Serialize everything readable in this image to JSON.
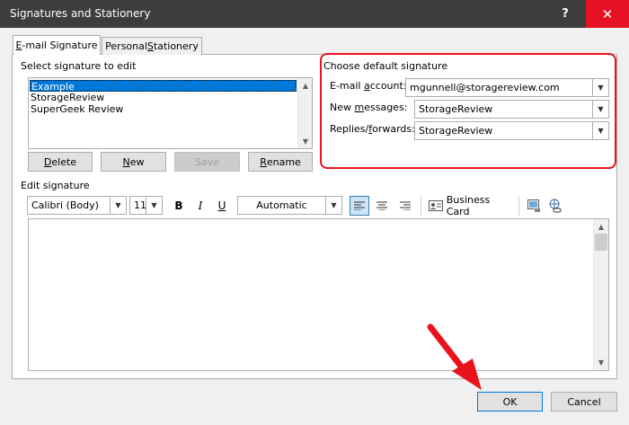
{
  "window": {
    "title": "Signatures and Stationery",
    "help_label": "?",
    "close_label": "✕"
  },
  "tabs": [
    {
      "label_accel": "E",
      "label_rest": "-mail Signature"
    },
    {
      "label_pre": "Personal ",
      "label_accel": "S",
      "label_rest": "tationery"
    }
  ],
  "select_signature": {
    "label": "Select signature to edit",
    "items": [
      "Example",
      "StorageReview",
      "SuperGeek Review"
    ],
    "selected": "Example"
  },
  "buttons": {
    "delete": {
      "accel": "D",
      "rest": "elete"
    },
    "new": {
      "accel": "N",
      "rest": "ew"
    },
    "save": "Save",
    "rename": {
      "accel": "R",
      "rest": "ename"
    },
    "ok": "OK",
    "cancel": "Cancel"
  },
  "default_signature": {
    "label": "Choose default signature",
    "email_account_label_pre": "E-mail ",
    "email_account_label_accel": "a",
    "email_account_label_rest": "ccount:",
    "email_account_value": "mgunnell@storagereview.com",
    "new_messages_label_pre": "New ",
    "new_messages_label_accel": "m",
    "new_messages_label_rest": "essages:",
    "new_messages_value": "StorageReview",
    "replies_label_pre": "Replies/",
    "replies_label_accel": "f",
    "replies_label_rest": "orwards:",
    "replies_value": "StorageReview"
  },
  "edit_signature": {
    "label": "Edit signature",
    "font": "Calibri (Body)",
    "size": "11",
    "bold": "B",
    "italic": "I",
    "underline": "U",
    "color": "Automatic",
    "business_card": "Business Card"
  },
  "colors": {
    "title_bar": "#3d3d3d",
    "close_hover": "#e81123",
    "highlight_box": "#e8131c",
    "selection": "#0078d7",
    "arrow": "#e8131c"
  }
}
